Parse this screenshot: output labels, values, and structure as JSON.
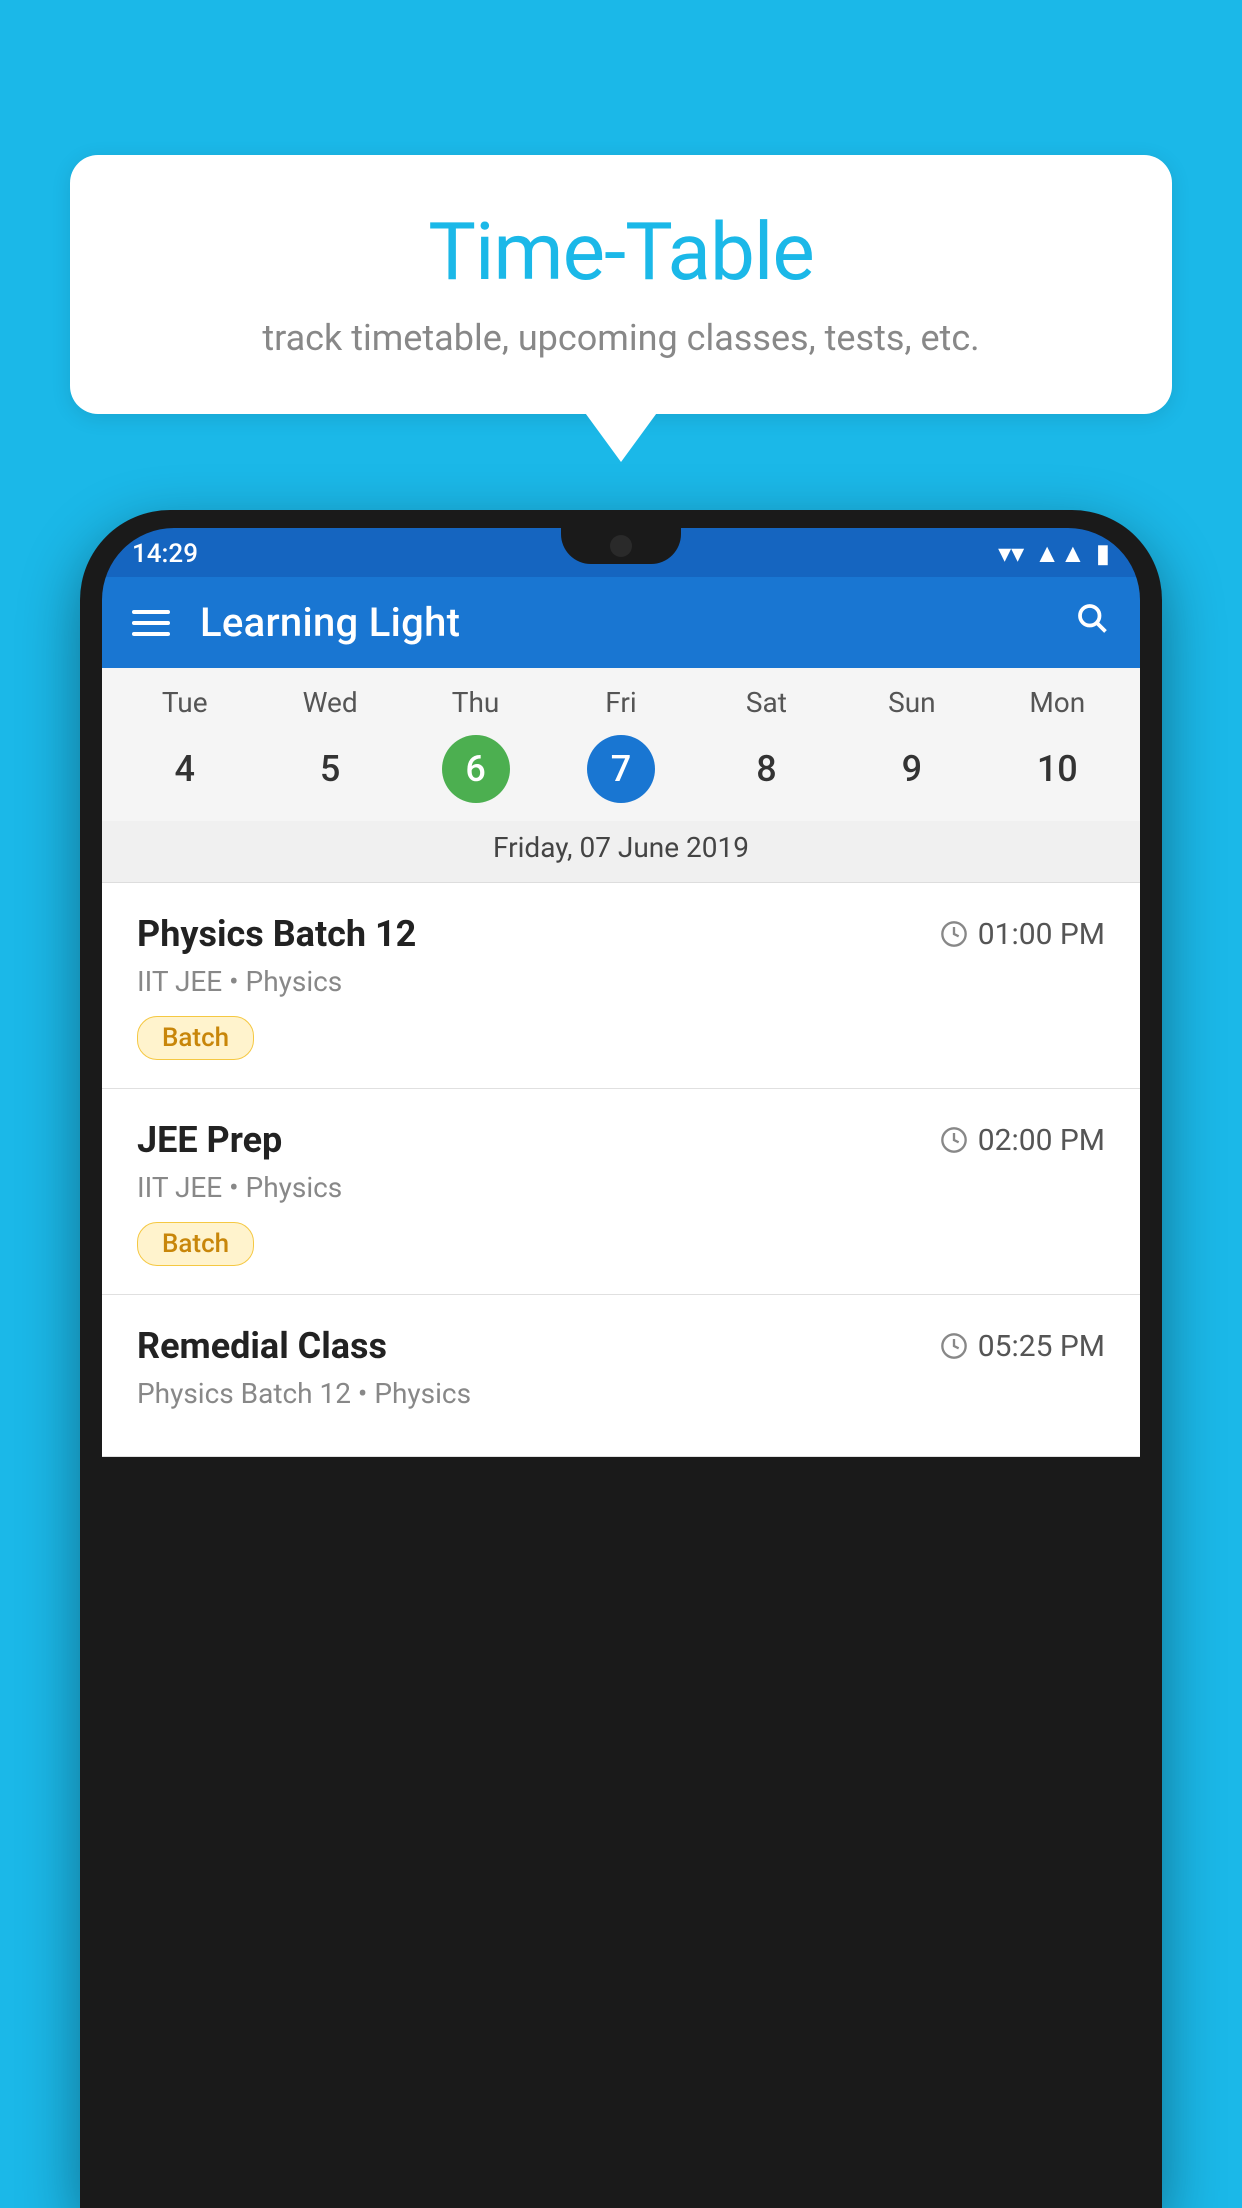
{
  "background_color": "#1BB8E8",
  "bubble": {
    "title": "Time-Table",
    "subtitle": "track timetable, upcoming classes, tests, etc."
  },
  "phone": {
    "status_time": "14:29",
    "app_title": "Learning Light",
    "calendar": {
      "day_names": [
        "Tue",
        "Wed",
        "Thu",
        "Fri",
        "Sat",
        "Sun",
        "Mon"
      ],
      "day_numbers": [
        "4",
        "5",
        "6",
        "7",
        "8",
        "9",
        "10"
      ],
      "today_index": 2,
      "selected_index": 3,
      "selected_date_label": "Friday, 07 June 2019"
    },
    "classes": [
      {
        "name": "Physics Batch 12",
        "time": "01:00 PM",
        "meta": "IIT JEE • Physics",
        "tag": "Batch"
      },
      {
        "name": "JEE Prep",
        "time": "02:00 PM",
        "meta": "IIT JEE • Physics",
        "tag": "Batch"
      },
      {
        "name": "Remedial Class",
        "time": "05:25 PM",
        "meta": "Physics Batch 12 • Physics",
        "tag": null
      }
    ]
  },
  "icons": {
    "hamburger": "☰",
    "search": "🔍",
    "clock": "🕐"
  }
}
